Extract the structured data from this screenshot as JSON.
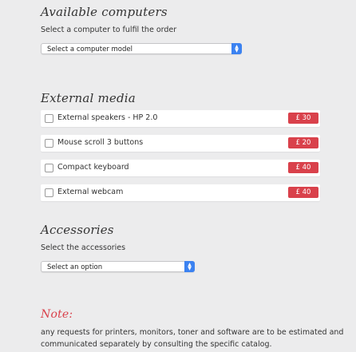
{
  "computers": {
    "title": "Available computers",
    "label": "Select a computer to fulfil the order",
    "select_value": "Select a computer model"
  },
  "media": {
    "title": "External media",
    "items": [
      {
        "name": "External speakers - HP 2.0",
        "price": "£ 30"
      },
      {
        "name": "Mouse scroll 3 buttons",
        "price": "£ 20"
      },
      {
        "name": "Compact keyboard",
        "price": "£ 40"
      },
      {
        "name": "External webcam",
        "price": "£ 40"
      }
    ]
  },
  "accessories": {
    "title": "Accessories",
    "label": "Select the accessories",
    "select_value": "Select an option"
  },
  "note": {
    "title": "Note:",
    "text": "any requests for printers, monitors, toner and software are to be estimated and communicated separately by consulting the specific catalog."
  },
  "colors": {
    "accent_red": "#d9414b",
    "select_blue": "#3b82f1",
    "background": "#ececed"
  }
}
